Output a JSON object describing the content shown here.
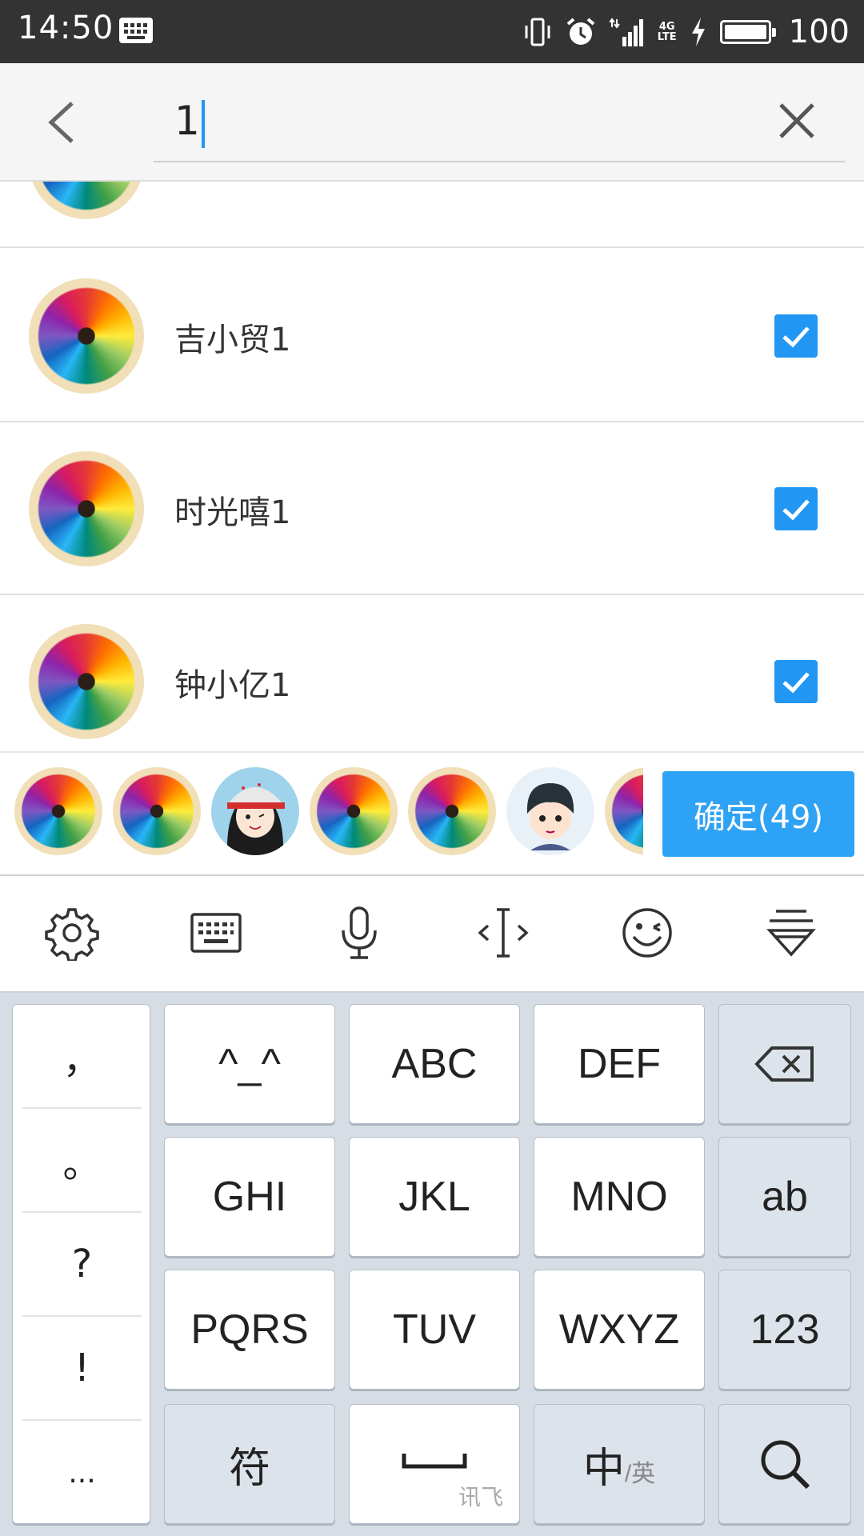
{
  "status_bar": {
    "time": "14:50",
    "battery": "100",
    "network": "4G",
    "network_sub": "LTE"
  },
  "search": {
    "value": "1"
  },
  "contacts": [
    {
      "name": "吉小贸1",
      "checked": true
    },
    {
      "name": "时光嘻1",
      "checked": true
    },
    {
      "name": "钟小亿1",
      "checked": true
    }
  ],
  "selected_bar": {
    "confirm_label": "确定(49)"
  },
  "keyboard": {
    "punctuation": [
      "，",
      "。",
      "?",
      "!",
      "..."
    ],
    "keys": {
      "emoticon": "^_^",
      "abc": "ABC",
      "def": "DEF",
      "ghi": "GHI",
      "jkl": "JKL",
      "mno": "MNO",
      "ab": "ab",
      "pqrs": "PQRS",
      "tuv": "TUV",
      "wxyz": "WXYZ",
      "num": "123",
      "symbol": "符",
      "space_brand": "讯飞",
      "lang_main": "中",
      "lang_sub": "/英"
    }
  },
  "icons": {
    "toolbar": [
      "settings-icon",
      "keyboard-icon",
      "microphone-icon",
      "cursor-icon",
      "emoji-icon",
      "collapse-keyboard-icon"
    ]
  }
}
